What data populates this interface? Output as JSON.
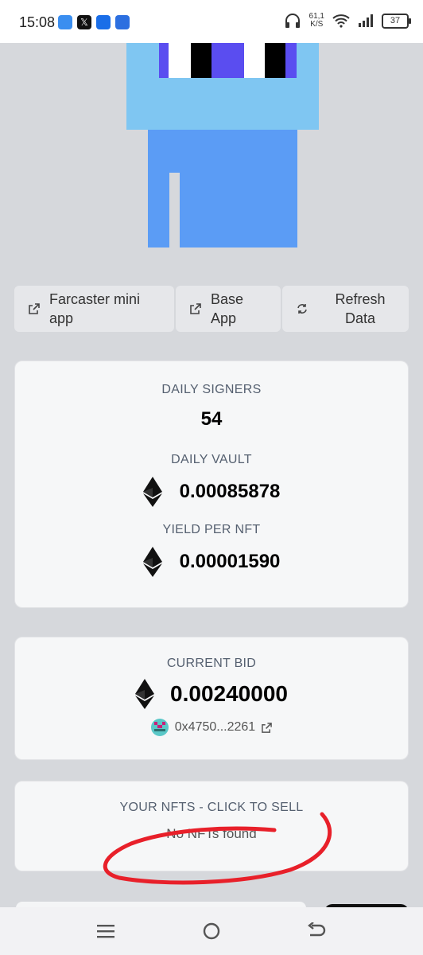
{
  "status_bar": {
    "time": "15:08",
    "net_speed_value": "61,1",
    "net_speed_unit": "K/S",
    "battery": "37"
  },
  "links": {
    "farcaster": "Farcaster mini app",
    "base": "Base App",
    "refresh": "Refresh Data"
  },
  "stats": {
    "daily_signers_label": "DAILY SIGNERS",
    "daily_signers_value": "54",
    "daily_vault_label": "DAILY VAULT",
    "daily_vault_value": "0.00085878",
    "yield_label": "YIELD PER NFT",
    "yield_value": "0.00001590"
  },
  "bid": {
    "label": "CURRENT BID",
    "value": "0.00240000",
    "bidder": "0x4750...2261"
  },
  "nfts": {
    "label": "YOUR NFTS - CLICK TO SELL",
    "empty": "No NFTs found"
  },
  "colors": {
    "pixel_light_blue": "#7fc6f2",
    "pixel_blue": "#5b9cf5",
    "pixel_purple": "#5a4df0",
    "annotation_red": "#e8202a"
  },
  "icons": [
    "external-link-icon",
    "refresh-icon",
    "ethereum-icon",
    "menu-icon",
    "home-icon",
    "back-icon"
  ]
}
